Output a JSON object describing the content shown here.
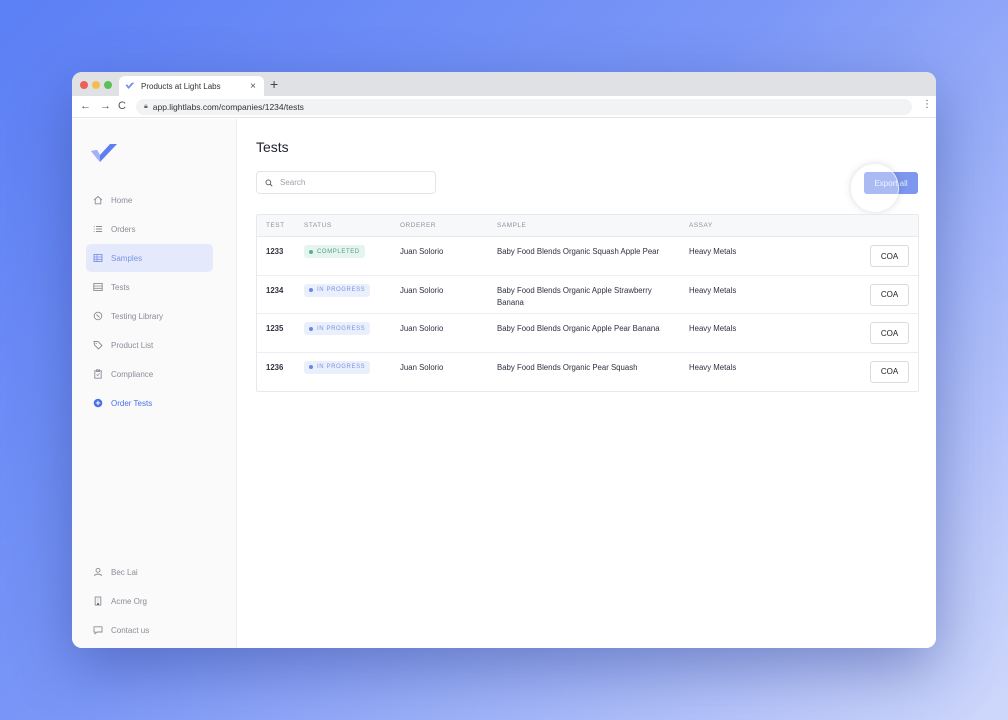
{
  "browser": {
    "tab_title": "Products at Light Labs",
    "tab_close": "×",
    "new_tab": "+",
    "url": "app.lightlabs.com/companies/1234/tests",
    "nav": {
      "back": "←",
      "forward": "→",
      "reload": "C"
    },
    "menu": "⋮"
  },
  "sidebar": {
    "items": [
      {
        "label": "Home",
        "icon": "home-icon"
      },
      {
        "label": "Orders",
        "icon": "list-icon"
      },
      {
        "label": "Samples",
        "icon": "grid-icon",
        "active": true
      },
      {
        "label": "Tests",
        "icon": "table-icon"
      },
      {
        "label": "Testing Library",
        "icon": "book-icon"
      },
      {
        "label": "Product List",
        "icon": "tag-icon"
      },
      {
        "label": "Compliance",
        "icon": "clipboard-icon"
      },
      {
        "label": "Order Tests",
        "icon": "plus-circle-icon",
        "accent": true
      }
    ],
    "footer": [
      {
        "label": "Bec Lai",
        "icon": "user-icon"
      },
      {
        "label": "Acme Org",
        "icon": "building-icon"
      },
      {
        "label": "Contact us",
        "icon": "chat-icon"
      }
    ]
  },
  "main": {
    "title": "Tests",
    "search": {
      "placeholder": "Search",
      "value": ""
    },
    "export_label": "Export all",
    "columns": [
      "TEST",
      "STATUS",
      "ORDERER",
      "SAMPLE",
      "ASSAY"
    ],
    "rows": [
      {
        "test": "1233",
        "status": "COMPLETED",
        "status_kind": "completed",
        "orderer": "Juan Solorio",
        "sample": "Baby Food Blends Organic Squash Apple Pear",
        "assay": "Heavy Metals",
        "action": "COA"
      },
      {
        "test": "1234",
        "status": "IN PROGRESS",
        "status_kind": "progress",
        "orderer": "Juan Solorio",
        "sample": "Baby Food Blends Organic Apple Strawberry Banana",
        "assay": "Heavy Metals",
        "action": "COA"
      },
      {
        "test": "1235",
        "status": "IN PROGRESS",
        "status_kind": "progress",
        "orderer": "Juan Solorio",
        "sample": "Baby Food Blends Organic Apple Pear Banana",
        "assay": "Heavy Metals",
        "action": "COA"
      },
      {
        "test": "1236",
        "status": "IN PROGRESS",
        "status_kind": "progress",
        "orderer": "Juan Solorio",
        "sample": "Baby Food Blends Organic Pear Squash",
        "assay": "Heavy Metals",
        "action": "COA"
      }
    ]
  },
  "colors": {
    "accent": "#7d97ee",
    "accent_text": "#4a70e8",
    "completed": "#4f9f84",
    "in_progress": "#7b93e6"
  }
}
